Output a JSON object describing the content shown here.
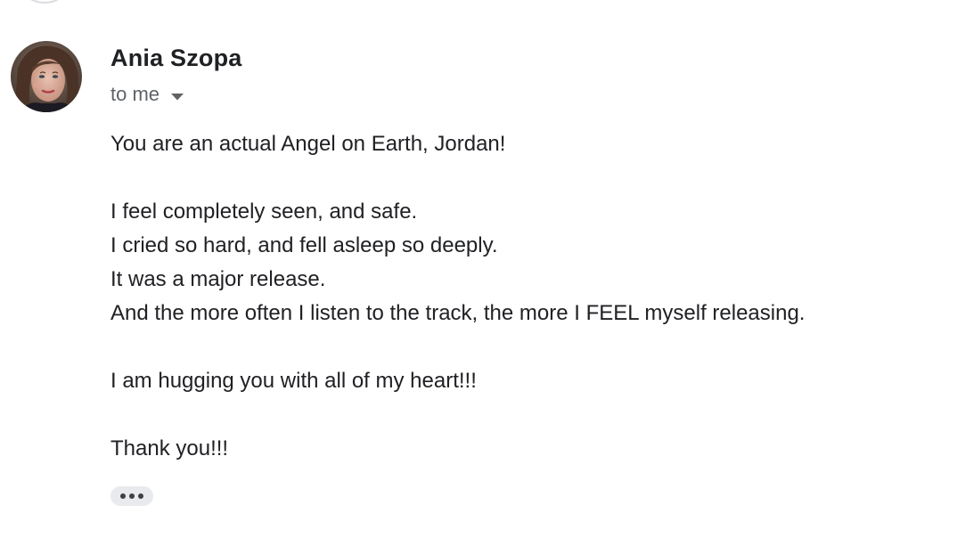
{
  "email": {
    "sender_name": "Ania Szopa",
    "recipient_label": "to me",
    "body_lines": [
      "You are an actual Angel on Earth, Jordan!",
      "",
      "I feel completely seen, and safe.",
      "I cried so hard, and fell asleep so deeply.",
      "It was a major release.",
      "And the more often I listen to the track, the more I FEEL myself releasing.",
      "",
      "I am hugging you with all of my heart!!!",
      "",
      "Thank you!!!"
    ]
  },
  "icons": {
    "avatar": "sender-avatar-photo",
    "recipient_dropdown": "chevron-down-icon",
    "more": "more-horiz-icon"
  },
  "colors": {
    "text_primary": "#202124",
    "text_secondary": "#5f6368",
    "more_button_bg": "#e8eaed"
  }
}
